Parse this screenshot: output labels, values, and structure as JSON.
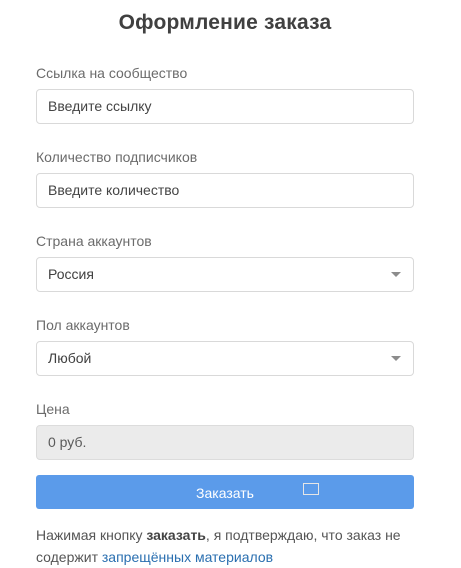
{
  "form": {
    "title": "Оформление заказа",
    "fields": {
      "community_link": {
        "label": "Ссылка на сообщество",
        "placeholder": "Введите ссылку"
      },
      "subscribers": {
        "label": "Количество подписчиков",
        "placeholder": "Введите количество"
      },
      "country": {
        "label": "Страна аккаунтов",
        "value": "Россия"
      },
      "gender": {
        "label": "Пол аккаунтов",
        "value": "Любой"
      },
      "price": {
        "label": "Цена",
        "value": "0 руб."
      }
    },
    "submit_label": "Заказать",
    "note": {
      "prefix": "Нажимая кнопку ",
      "emphasis": "заказать",
      "middle": ", я подтверждаю, что заказ не содержит ",
      "link": "запрещённых материалов"
    }
  },
  "colors": {
    "button_bg": "#5b9bea",
    "link": "#2a6fb0",
    "readonly_bg": "#ebebeb"
  },
  "icons": {
    "select_caret": "caret-down-icon"
  }
}
